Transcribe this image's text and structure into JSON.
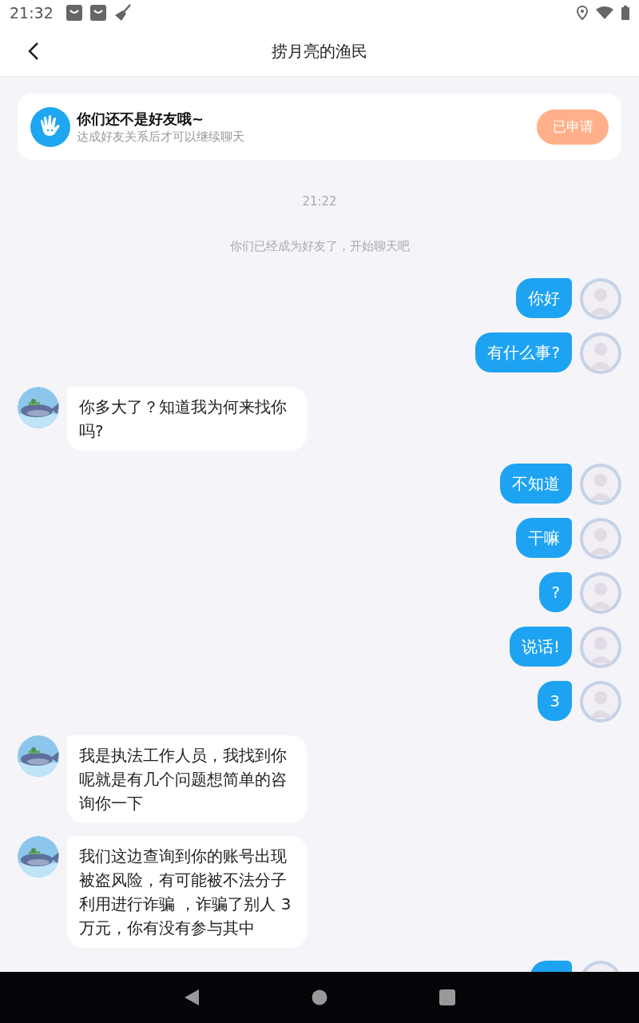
{
  "status_bar": {
    "time": "21:32"
  },
  "header": {
    "title": "捞月亮的渔民"
  },
  "friend_notice": {
    "title": "你们还不是好友哦~",
    "subtitle": "达成好友关系后才可以继续聊天",
    "button": "已申请",
    "button_disabled": true
  },
  "messages": [
    {
      "kind": "time",
      "text": "21:22"
    },
    {
      "kind": "system",
      "text": "你们已经成为好友了，开始聊天吧"
    },
    {
      "kind": "sent",
      "text": "你好"
    },
    {
      "kind": "sent",
      "text": "有什么事?"
    },
    {
      "kind": "received",
      "text": "你多大了？知道我为何来找你吗?"
    },
    {
      "kind": "sent",
      "text": "不知道"
    },
    {
      "kind": "sent",
      "text": "干嘛"
    },
    {
      "kind": "sent",
      "text": "?"
    },
    {
      "kind": "sent",
      "text": "说话!"
    },
    {
      "kind": "sent",
      "text": "3"
    },
    {
      "kind": "received",
      "text": "我是执法工作人员，我找到你呢就是有几个问题想简单的咨询你一下"
    },
    {
      "kind": "received",
      "text": "我们这边查询到你的账号出现被盗风险，有可能被不法分子利用进行诈骗 ，诈骗了别人 3万元，你有没有参与其中"
    },
    {
      "kind": "sent"
    }
  ]
}
